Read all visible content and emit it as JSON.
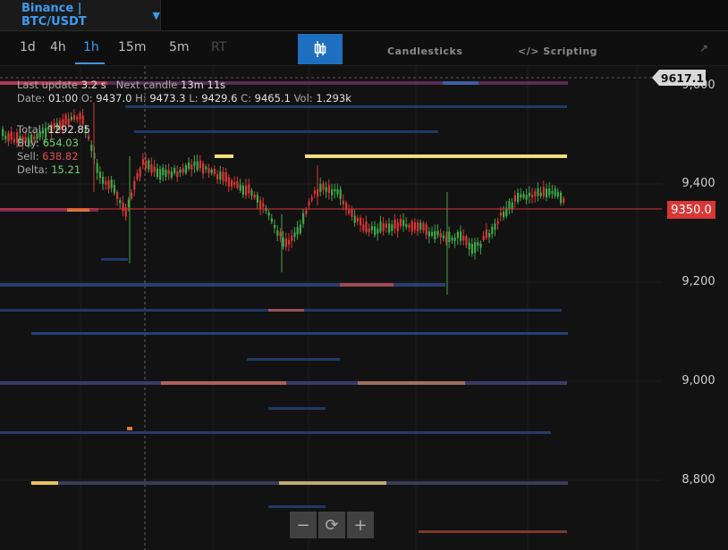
{
  "header": {
    "market_label": "Binance | BTC/USDT"
  },
  "timeframes": [
    {
      "label": "1d"
    },
    {
      "label": "4h"
    },
    {
      "label": "1h"
    },
    {
      "label": "15m"
    },
    {
      "label": "5m"
    },
    {
      "label": "RT"
    }
  ],
  "active_timeframe": "1h",
  "tabs": {
    "candlesticks": "Candlesticks",
    "scripting": "Scripting"
  },
  "status": {
    "last_update_label": "Last update",
    "last_update_value": "3.2 s",
    "next_candle_label": "Next candle",
    "next_candle_value": "13m 11s"
  },
  "ohlc": {
    "date_label": "Date:",
    "date": "01:00",
    "open_label": "O:",
    "open": "9437.0",
    "high_label": "H:",
    "high": "9473.3",
    "low_label": "L:",
    "low": "9429.6",
    "close_label": "C:",
    "close": "9465.1",
    "vol_label": "Vol:",
    "vol": "1.293k"
  },
  "volume_stats": {
    "total_label": "Total:",
    "total": "1292.85",
    "buy_label": "Buy:",
    "buy": "654.03",
    "sell_label": "Sell:",
    "sell": "638.82",
    "delta_label": "Delta:",
    "delta": "15.21"
  },
  "price_axis": {
    "ticks": [
      "9,600",
      "9,400",
      "9,200",
      "9,000",
      "8,800"
    ]
  },
  "tags": {
    "high_marker": "9617.1",
    "current_price": "9350.0"
  },
  "zoom_controls": {
    "minus": "−",
    "reset": "⟳",
    "plus": "+"
  },
  "colors": {
    "accent": "#3d9af0",
    "up": "#3fa84a",
    "down": "#d93636",
    "resting_order": "#f0e07a"
  }
}
